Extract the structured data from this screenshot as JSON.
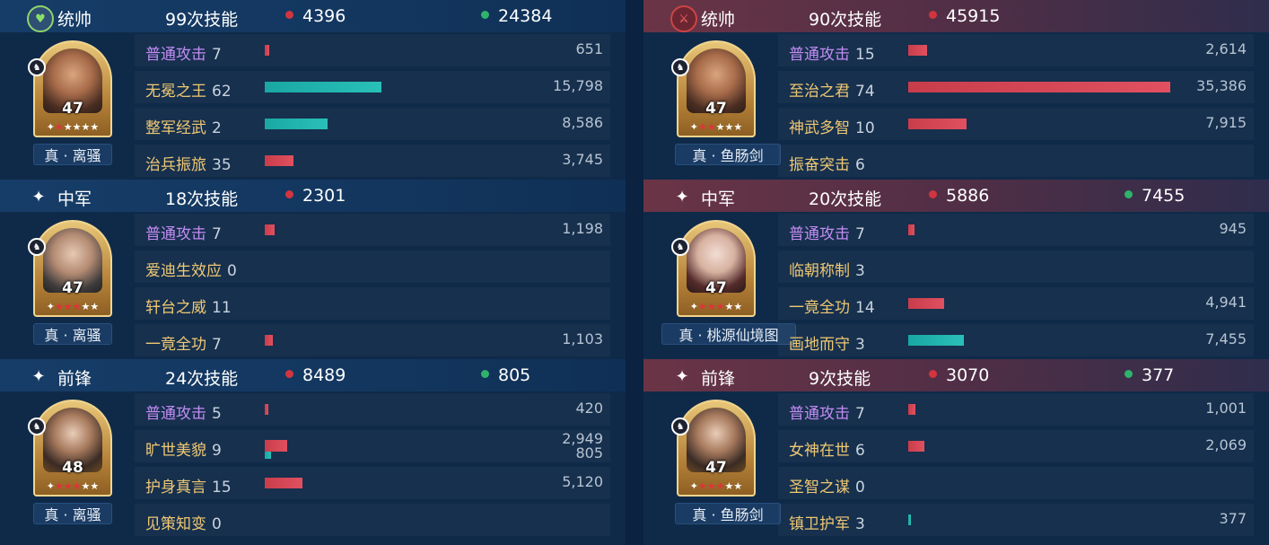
{
  "left": {
    "units": [
      {
        "role": "统帅",
        "count": "99次技能",
        "damage": "4396",
        "heal": "24384",
        "level": "47",
        "red_stars": 1,
        "equip": "真 · 离骚",
        "skills": [
          {
            "name": "普通攻击",
            "uses": "7",
            "bars": [
              {
                "color": "red",
                "pct": 1.5
              }
            ],
            "values": [
              "651"
            ]
          },
          {
            "name": "无冕之王",
            "uses": "62",
            "bars": [
              {
                "color": "teal",
                "pct": 37
              }
            ],
            "values": [
              "15,798"
            ]
          },
          {
            "name": "整军经武",
            "uses": "2",
            "bars": [
              {
                "color": "teal",
                "pct": 20
              }
            ],
            "values": [
              "8,586"
            ]
          },
          {
            "name": "治兵振旅",
            "uses": "35",
            "bars": [
              {
                "color": "red",
                "pct": 9
              }
            ],
            "values": [
              "3,745"
            ]
          }
        ]
      },
      {
        "role": "中军",
        "count": "18次技能",
        "damage": "2301",
        "heal": "",
        "level": "47",
        "red_stars": 3,
        "equip": "真 · 离骚",
        "skills": [
          {
            "name": "普通攻击",
            "uses": "7",
            "bars": [
              {
                "color": "red",
                "pct": 3
              }
            ],
            "values": [
              "1,198"
            ]
          },
          {
            "name": "爱迪生效应",
            "uses": "0",
            "bars": [],
            "values": []
          },
          {
            "name": "轩台之威",
            "uses": "11",
            "bars": [],
            "values": []
          },
          {
            "name": "一竟全功",
            "uses": "7",
            "bars": [
              {
                "color": "red",
                "pct": 2.5
              }
            ],
            "values": [
              "1,103"
            ]
          }
        ]
      },
      {
        "role": "前锋",
        "count": "24次技能",
        "damage": "8489",
        "heal": "805",
        "level": "48",
        "red_stars": 3,
        "equip": "真 · 离骚",
        "skills": [
          {
            "name": "普通攻击",
            "uses": "5",
            "bars": [
              {
                "color": "red",
                "pct": 1
              }
            ],
            "values": [
              "420"
            ]
          },
          {
            "name": "旷世美貌",
            "uses": "9",
            "bars": [
              {
                "color": "red",
                "pct": 7
              },
              {
                "color": "teal",
                "pct": 2
              }
            ],
            "values": [
              "2,949",
              "805"
            ]
          },
          {
            "name": "护身真言",
            "uses": "15",
            "bars": [
              {
                "color": "red",
                "pct": 12
              }
            ],
            "values": [
              "5,120"
            ]
          },
          {
            "name": "见策知变",
            "uses": "0",
            "bars": [],
            "values": []
          }
        ]
      }
    ]
  },
  "right": {
    "units": [
      {
        "role": "统帅",
        "count": "90次技能",
        "damage": "45915",
        "heal": "",
        "level": "47",
        "red_stars": 2,
        "equip": "真 · 鱼肠剑",
        "skills": [
          {
            "name": "普通攻击",
            "uses": "15",
            "bars": [
              {
                "color": "red",
                "pct": 6
              }
            ],
            "values": [
              "2,614"
            ]
          },
          {
            "name": "至治之君",
            "uses": "74",
            "bars": [
              {
                "color": "red",
                "pct": 83
              }
            ],
            "values": [
              "35,386"
            ]
          },
          {
            "name": "神武多智",
            "uses": "10",
            "bars": [
              {
                "color": "red",
                "pct": 18.5
              }
            ],
            "values": [
              "7,915"
            ]
          },
          {
            "name": "振奋突击",
            "uses": "6",
            "bars": [],
            "values": []
          }
        ]
      },
      {
        "role": "中军",
        "count": "20次技能",
        "damage": "5886",
        "heal": "7455",
        "level": "47",
        "red_stars": 3,
        "equip": "真 · 桃源仙境图",
        "skills": [
          {
            "name": "普通攻击",
            "uses": "7",
            "bars": [
              {
                "color": "red",
                "pct": 2
              }
            ],
            "values": [
              "945"
            ]
          },
          {
            "name": "临朝称制",
            "uses": "3",
            "bars": [],
            "values": []
          },
          {
            "name": "一竟全功",
            "uses": "14",
            "bars": [
              {
                "color": "red",
                "pct": 11.5
              }
            ],
            "values": [
              "4,941"
            ]
          },
          {
            "name": "画地而守",
            "uses": "3",
            "bars": [
              {
                "color": "teal",
                "pct": 17.5
              }
            ],
            "values": [
              "7,455"
            ]
          }
        ]
      },
      {
        "role": "前锋",
        "count": "9次技能",
        "damage": "3070",
        "heal": "377",
        "level": "47",
        "red_stars": 3,
        "equip": "真 · 鱼肠剑",
        "skills": [
          {
            "name": "普通攻击",
            "uses": "7",
            "bars": [
              {
                "color": "red",
                "pct": 2.3
              }
            ],
            "values": [
              "1,001"
            ]
          },
          {
            "name": "女神在世",
            "uses": "6",
            "bars": [
              {
                "color": "red",
                "pct": 5
              }
            ],
            "values": [
              "2,069"
            ]
          },
          {
            "name": "圣智之谋",
            "uses": "0",
            "bars": [],
            "values": []
          },
          {
            "name": "镇卫护军",
            "uses": "3",
            "bars": [
              {
                "color": "teal",
                "pct": 0.5
              }
            ],
            "values": [
              "377"
            ]
          }
        ]
      }
    ]
  },
  "icons": {
    "commander_left": "green-shield-icon",
    "commander_right": "red-sword-shield-icon",
    "other_roles": "star-icon",
    "avatar_badge": "mount-icon"
  },
  "colors": {
    "attack_name": "#c38cf2",
    "skill_name": "#f0c873",
    "damage_bar": "#d4404f",
    "heal_bar": "#1fb2ad",
    "damage_dot": "#d2353f",
    "heal_dot": "#2fb36b"
  }
}
